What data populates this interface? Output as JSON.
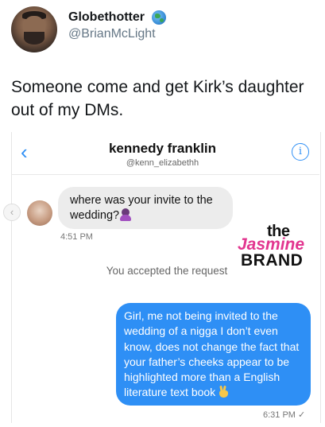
{
  "tweet": {
    "display_name": "Globethotter",
    "name_emoji": "globe-icon",
    "handle": "@BrianMcLight",
    "text": "Someone come and get Kirk’s daughter out of my DMs."
  },
  "dm": {
    "back_icon": "chevron-left-icon",
    "contact_name": "kennedy franklin",
    "contact_username": "@kenn_elizabethh",
    "info_icon": "info-icon",
    "info_glyph": "i",
    "side_arrow_glyph": "‹",
    "incoming_message": "where was your invite to the wedding?",
    "incoming_emoji": "woman-gesturing-no-icon",
    "incoming_time": "4:51 PM",
    "system_message": "You accepted the request",
    "outgoing_message": "Girl, me not being invited to the wedding of a nigga I don’t even know, does not change the fact that your father’s cheeks appear to be highlighted more than a English literature text book",
    "outgoing_emoji": "victory-hand-icon",
    "outgoing_time": "6:31 PM",
    "read_glyph": "✓"
  },
  "watermark": {
    "line1": "the",
    "line2": "Jasmine",
    "line3": "BRAND"
  },
  "colors": {
    "accent_blue": "#2e8ff5",
    "watermark_pink": "#e2358f"
  }
}
